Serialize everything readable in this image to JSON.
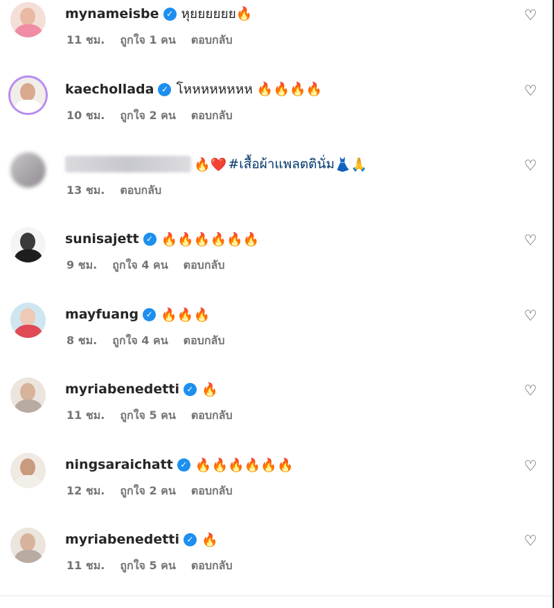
{
  "comments": [
    {
      "user": "mynameisbe",
      "verified": true,
      "text": "หุยยยยยย🔥",
      "time": "11 ชม.",
      "likes": "ถูกใจ 1 คน",
      "reply": "ตอบกลับ"
    },
    {
      "user": "kaechollada",
      "verified": true,
      "text": "โหหหหหหหห 🔥🔥🔥🔥",
      "time": "10 ชม.",
      "likes": "ถูกใจ 2 คน",
      "reply": "ตอบกลับ"
    },
    {
      "user": "",
      "verified": false,
      "text": "🔥❤️",
      "hashtag": "#เสื้อผ้าแพลตตินั่ม",
      "text_suffix": "👗🙏",
      "time": "13 ชม.",
      "likes": "",
      "reply": "ตอบกลับ"
    },
    {
      "user": "sunisajett",
      "verified": true,
      "text": "🔥🔥🔥🔥🔥🔥",
      "time": "9 ชม.",
      "likes": "ถูกใจ 4 คน",
      "reply": "ตอบกลับ"
    },
    {
      "user": "mayfuang",
      "verified": true,
      "text": "🔥🔥🔥",
      "time": "8 ชม.",
      "likes": "ถูกใจ 4 คน",
      "reply": "ตอบกลับ"
    },
    {
      "user": "myriabenedetti",
      "verified": true,
      "text": "🔥",
      "time": "11 ชม.",
      "likes": "ถูกใจ 5 คน",
      "reply": "ตอบกลับ"
    },
    {
      "user": "ningsaraichatt",
      "verified": true,
      "text": "🔥🔥🔥🔥🔥🔥",
      "time": "12 ชม.",
      "likes": "ถูกใจ 2 คน",
      "reply": "ตอบกลับ"
    },
    {
      "user": "myriabenedetti",
      "verified": true,
      "text": "🔥",
      "time": "11 ชม.",
      "likes": "ถูกใจ 5 คน",
      "reply": "ตอบกลับ"
    }
  ],
  "icons": {
    "verified": "verified-badge-icon",
    "like": "heart-outline-icon"
  },
  "colors": {
    "verified_badge": "#1d8fef",
    "hashtag": "#00376b",
    "meta_text": "#737373"
  }
}
